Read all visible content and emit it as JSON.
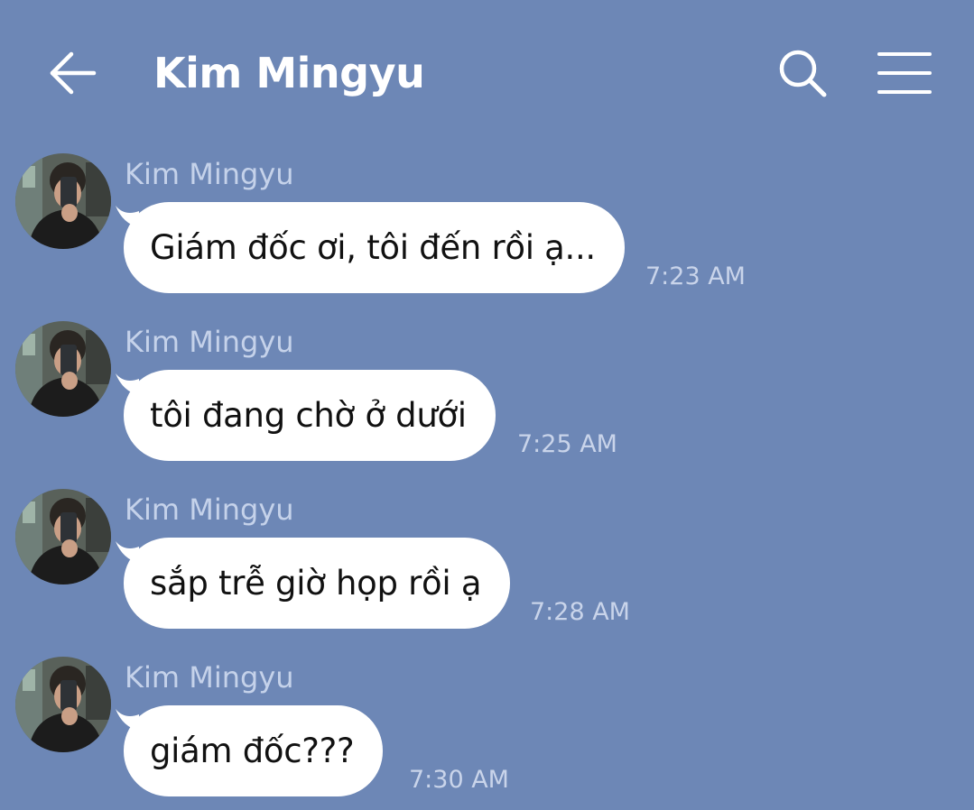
{
  "header": {
    "title": "Kim Mingyu",
    "back_icon": "arrow-left-icon",
    "search_icon": "search-icon",
    "menu_icon": "hamburger-menu-icon"
  },
  "colors": {
    "background": "#6d87b6",
    "bubble": "#ffffff",
    "header_text": "#ffffff",
    "sender_text": "#c5d2ea",
    "timestamp_text": "#c9d4ea"
  },
  "messages": [
    {
      "sender": "Kim Mingyu",
      "text": "Giám đốc ơi, tôi đến rồi ạ...",
      "time": "7:23 AM"
    },
    {
      "sender": "Kim Mingyu",
      "text": "tôi đang chờ ở dưới",
      "time": "7:25 AM"
    },
    {
      "sender": "Kim Mingyu",
      "text": "sắp trễ giờ họp rồi ạ",
      "time": "7:28 AM"
    },
    {
      "sender": "Kim Mingyu",
      "text": "giám đốc???",
      "time": "7:30 AM"
    }
  ]
}
